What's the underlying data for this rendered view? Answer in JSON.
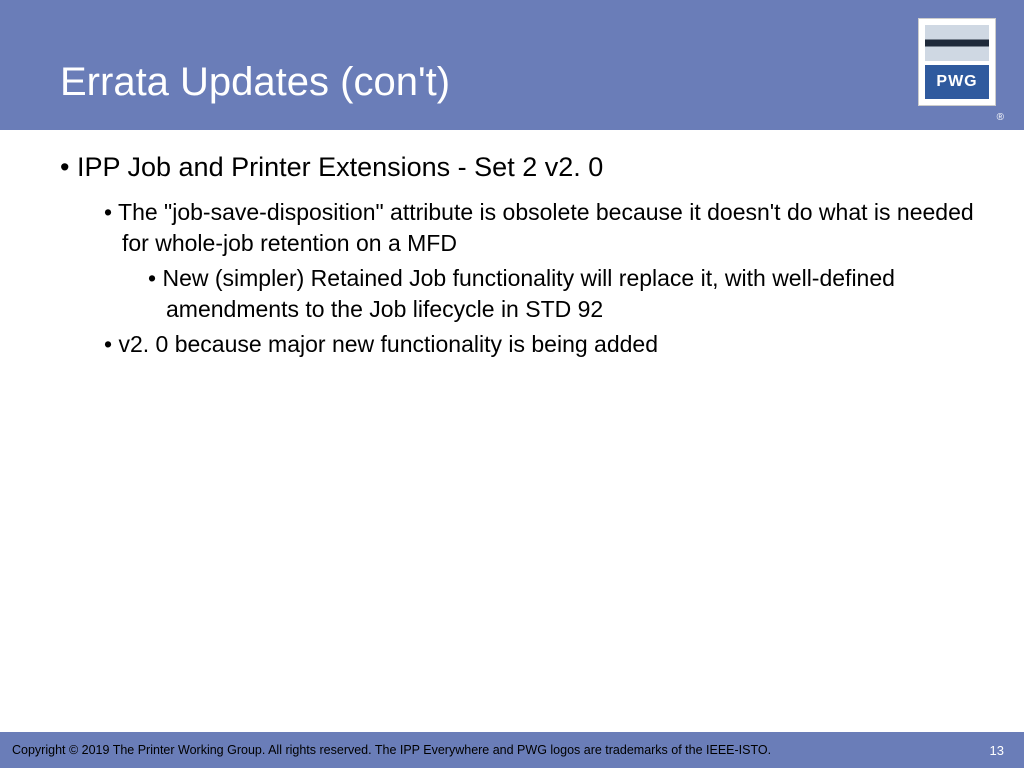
{
  "header": {
    "title": "Errata Updates (con't)",
    "logo_text": "PWG",
    "reg_mark": "®"
  },
  "content": {
    "lvl1_1": "IPP Job and Printer Extensions - Set 2 v2. 0",
    "lvl2_1": "The \"job-save-disposition\" attribute is obsolete because it doesn't do what is needed for whole-job retention on a MFD",
    "lvl3_1": "New (simpler) Retained Job functionality will replace it, with well-defined amendments to the Job lifecycle in STD 92",
    "lvl2_2": "v2. 0 because major new functionality is being added"
  },
  "footer": {
    "copyright": "Copyright © 2019 The Printer Working Group. All rights reserved. The IPP Everywhere and PWG logos are trademarks of the IEEE-ISTO.",
    "page": "13"
  }
}
